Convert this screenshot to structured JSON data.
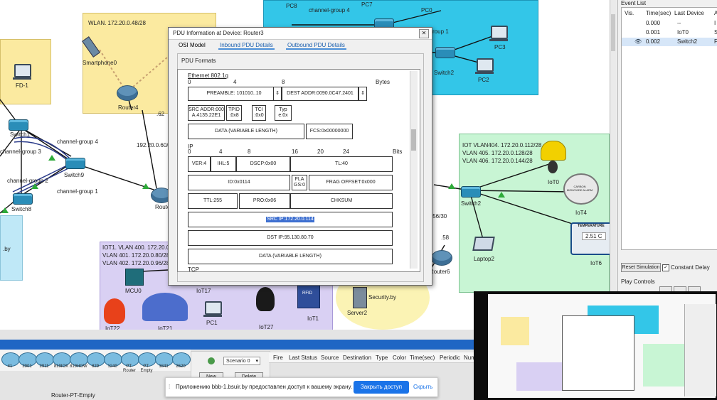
{
  "topology": {
    "wlan_label": "WLAN. 172.20.0.48/28",
    "smartphone_label": "Smartphone0",
    "router4_label": "Router4",
    "ip_62": ".62",
    "net_192": "192.20.0.60/3",
    "router_label": "Route",
    "fd1_label": "FD-1",
    "switch8_label": "Switch8",
    "switch9_label": "Switch9",
    "switch1_label": "Switch1",
    "cg3": "channel-group 3",
    "cg4a": "channel-group 4",
    "cg2": "channel-group 2",
    "cg1a": "channel-group 1",
    "by_left": ".by",
    "pc8": "PC8",
    "cg4b": "channel-group 4",
    "pc7": "PC7",
    "pc0": "PC0",
    "roup1": "roup 1",
    "pc3": "PC3",
    "pc2": "PC2",
    "switch2_top": "Switch2",
    "iot_zone_lines": [
      "IOT VLAN404. 172.20.0.112/28",
      "VLAN 405. 172.20.0.128/28",
      "VLAN 406. 172.20.0.144/28"
    ],
    "iot0": "IoT0",
    "iot4": "IoT4",
    "co_alarm": "CARBON MONOXIDE ALARM",
    "temp_label": "TEMPERATURE",
    "temp_value": "2.51 C",
    "iot6": "IoT6",
    "switch2": "Switch2",
    "laptop2": "Laptop2",
    "router6": "Router6",
    "ip_56": ".56/30",
    "ip_58": ".58",
    "vlan_lines": [
      "IOT1. VLAN 400. 172.20.0.?/28",
      "VLAN 401. 172.20.0.80/28",
      "VLAN 402. 172.20.0.96/28"
    ],
    "mcu0": "MCU0",
    "iot17": "IoT17",
    "pc1": "PC1",
    "iot27": "IoT27",
    "iot1": "IoT1",
    "rfid": "RFID",
    "iot22": "IoT22",
    "iot21": "IoT21",
    "security": "Security.by",
    "server2": "Server2"
  },
  "dialog": {
    "title": "PDU Information at Device: Router3",
    "close": "✕",
    "tabs": [
      "OSI Model",
      "Inbound PDU Details",
      "Outbound PDU Details"
    ],
    "formats_label": "PDU Formats",
    "eth_title": "Ethernet 802.1q",
    "ruler_eth": [
      "0",
      "4",
      "8",
      "Bytes"
    ],
    "eth_fields": {
      "preamble": "PREAMBLE: 101010..10",
      "dest": "DEST ADDR:0090.0C47.2401",
      "src": "SRC ADDR:000 A.4135.22E1",
      "tpid": "TPID :0x8",
      "tci": "TCI :0x0",
      "typ": "Typ e:0x",
      "data": "DATA (VARIABLE LENGTH)",
      "fcs": "FCS:0x00000000"
    },
    "ip_title": "IP",
    "ruler_ip": [
      "0",
      "4",
      "8",
      "16",
      "20",
      "24",
      "Bits"
    ],
    "ip_fields": {
      "ver": "VER:4",
      "ihl": "IHL:5",
      "dscp": "DSCP:0x00",
      "tl": "TL:40",
      "id": "ID:0x0114",
      "flags": "FLA GS:0",
      "frag": "FRAG OFFSET:0x000",
      "ttl": "TTL:255",
      "pro": "PRO:0x06",
      "chksum": "CHKSUM",
      "src": "SRC IP:172.20.0.114",
      "dst": "DST IP:95.130.80.70",
      "data": "DATA (VARIABLE LENGTH)"
    },
    "tcp_title": "TCP"
  },
  "event_panel": {
    "title": "Event List",
    "headers": [
      "Vis.",
      "Time(sec)",
      "Last Device",
      "A"
    ],
    "rows": [
      {
        "time": "0.000",
        "last": "--",
        "a": "I"
      },
      {
        "time": "0.001",
        "last": "IoT0",
        "a": "S"
      },
      {
        "time": "0.002",
        "last": "Switch2",
        "a": "F"
      }
    ],
    "reset": "Reset Simulation",
    "constant": "Constant Delay",
    "play": "Play Controls"
  },
  "bottom": {
    "devices": [
      "41",
      "2901",
      "2911",
      "819IOX",
      "819HGW",
      "829",
      "1240",
      "PT-Router",
      "PT-Empty",
      "1841",
      "2620"
    ],
    "selected_device": "Router-PT-Empty",
    "scenario": "Scenario 0",
    "new_btn": "New",
    "delete_btn": "Delete",
    "headers": [
      "Fire",
      "Last Status",
      "Source",
      "Destination",
      "Type",
      "Color",
      "Time(sec)",
      "Periodic",
      "Num"
    ]
  },
  "notify": {
    "text": "Приложению bbb-1.bsuir.by предоставлен доступ к вашему экрану.",
    "share_btn": "Закрыть доступ",
    "hide_btn": "Скрыть"
  },
  "colors": {
    "accent": "#1a73e8",
    "cyan_zone": "#33c6e8",
    "yellow_zone": "#fbeaa0",
    "green_zone": "#c8f5d4",
    "purple_zone": "#d9d0f3"
  }
}
